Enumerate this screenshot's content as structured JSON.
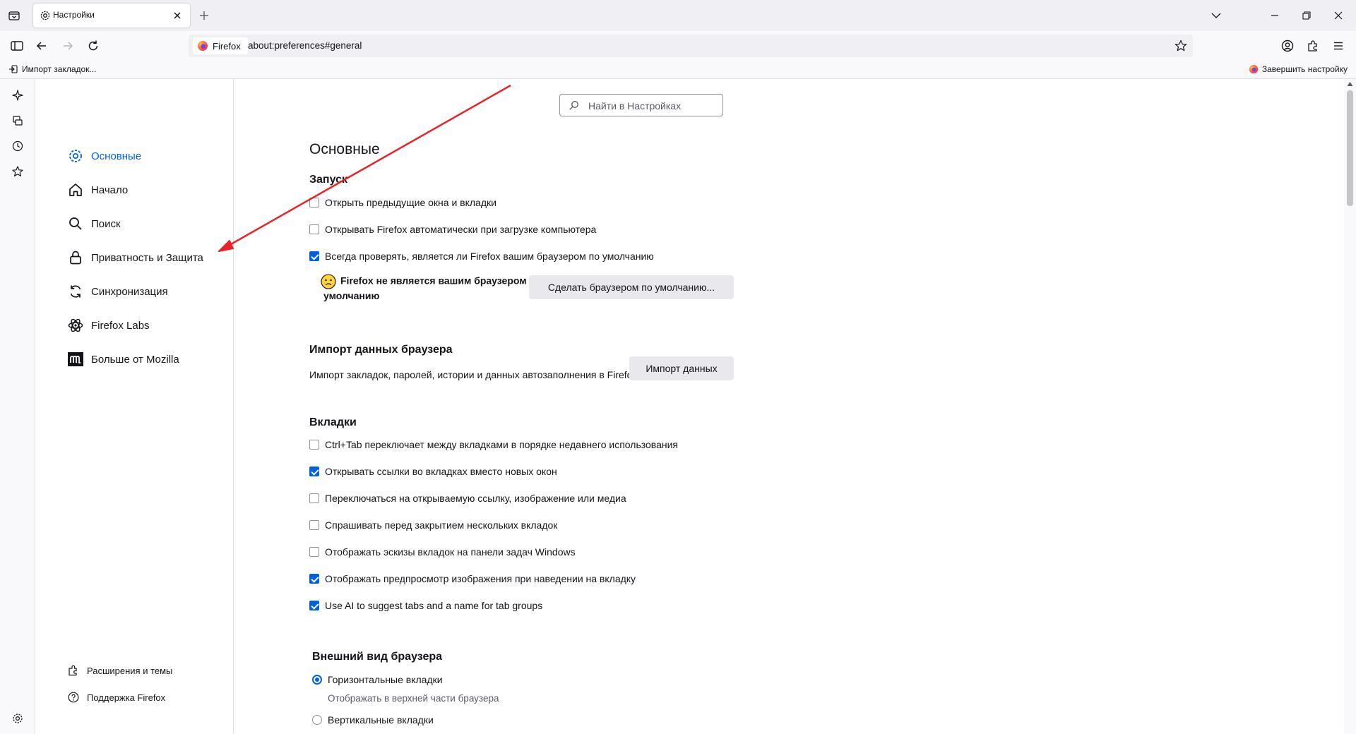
{
  "tab": {
    "title": "Настройки"
  },
  "url": {
    "identity": "Firefox",
    "address": "about:preferences#general"
  },
  "bookmarks": {
    "import": "Импорт закладок...",
    "finish_setup": "Завершить настройку"
  },
  "search": {
    "placeholder": "Найти в Настройках"
  },
  "categories": [
    {
      "label": "Основные",
      "icon": "gear-icon",
      "active": true
    },
    {
      "label": "Начало",
      "icon": "home-icon"
    },
    {
      "label": "Поиск",
      "icon": "search-icon"
    },
    {
      "label": "Приватность и Защита",
      "icon": "lock-icon"
    },
    {
      "label": "Синхронизация",
      "icon": "sync-icon"
    },
    {
      "label": "Firefox Labs",
      "icon": "labs-icon"
    },
    {
      "label": "Больше от Mozilla",
      "icon": "mozilla-icon"
    }
  ],
  "footer_links": {
    "extensions": "Расширения и темы",
    "support": "Поддержка Firefox"
  },
  "page": {
    "title": "Основные",
    "startup": {
      "heading": "Запуск",
      "restore": "Открыть предыдущие окна и вкладки",
      "autostart": "Открывать Firefox автоматически при загрузке компьютера",
      "check_default": "Всегда проверять, является ли Firefox вашим браузером по умолчанию",
      "not_default": "Firefox не является вашим браузером по умолчанию",
      "make_default": "Сделать браузером по умолчанию..."
    },
    "import": {
      "heading": "Импорт данных браузера",
      "description": "Импорт закладок, паролей, истории и данных автозаполнения в Firefox.",
      "button": "Импорт данных"
    },
    "tabs": {
      "heading": "Вкладки",
      "ctrl_tab": "Ctrl+Tab переключает между вкладками в порядке недавнего использования",
      "open_links": "Открывать ссылки во вкладках вместо новых окон",
      "switch_to": "Переключаться на открываемую ссылку, изображение или медиа",
      "warn_close": "Спрашивать перед закрытием нескольких вкладок",
      "taskbar": "Отображать эскизы вкладок на панели задач Windows",
      "preview": "Отображать предпросмотр изображения при наведении на вкладку",
      "ai_groups": "Use AI to suggest tabs and a name for tab groups"
    },
    "appearance": {
      "heading": "Внешний вид браузера",
      "horizontal": "Горизонтальные вкладки",
      "horizontal_sub": "Отображать в верхней части браузера",
      "vertical": "Вертикальные вкладки"
    }
  },
  "colors": {
    "accent": "#0061e0",
    "annotation_arrow": "#e8232a"
  }
}
